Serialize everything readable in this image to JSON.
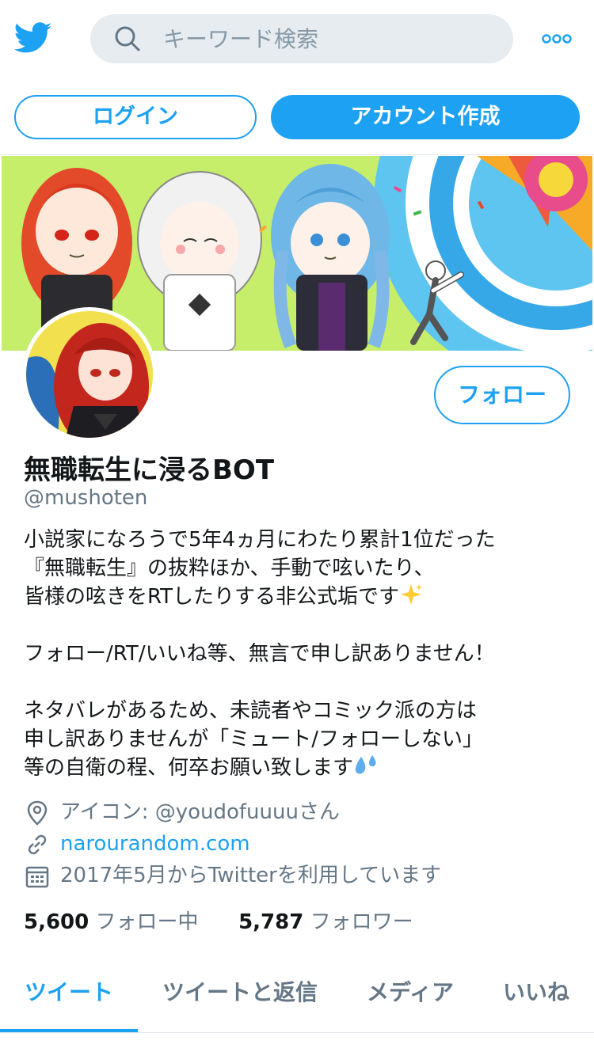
{
  "header": {
    "search_placeholder": "キーワード検索"
  },
  "auth": {
    "login_label": "ログイン",
    "signup_label": "アカウント作成"
  },
  "profile": {
    "follow_label": "フォロー",
    "name": "無職転生に浸るBOT",
    "handle": "@mushoten",
    "bio_lines": [
      "小説家になろうで5年4ヵ月にわたり累計1位だった",
      "『無職転生』の抜粋ほか、手動で呟いたり、",
      "皆様の呟きをRTしたりする非公式垢です",
      "フォロー/RT/いいね等、無言で申し訳ありません！",
      "ネタバレがあるため、未読者やコミック派の方は",
      "申し訳ありませんが「ミュート/フォローしない」",
      "等の自衛の程、何卒お願い致します"
    ],
    "location": "アイコン: @youdofuuuuさん",
    "url": "narourandom.com",
    "joined": "2017年5月からTwitterを利用しています",
    "following_count": "5,600",
    "following_label": "フォロー中",
    "followers_count": "5,787",
    "followers_label": "フォロワー"
  },
  "tabs": [
    {
      "label": "ツイート",
      "active": true
    },
    {
      "label": "ツイートと返信",
      "active": false
    },
    {
      "label": "メディア",
      "active": false
    },
    {
      "label": "いいね",
      "active": false
    }
  ],
  "colors": {
    "accent": "#1da1f2",
    "secondary_text": "#657786",
    "search_bg": "#e6ecf0"
  },
  "icons": [
    "twitter-bird-icon",
    "search-icon",
    "more-icon",
    "location-icon",
    "link-icon",
    "calendar-icon",
    "sparkles-emoji",
    "sweat-droplets-emoji"
  ]
}
